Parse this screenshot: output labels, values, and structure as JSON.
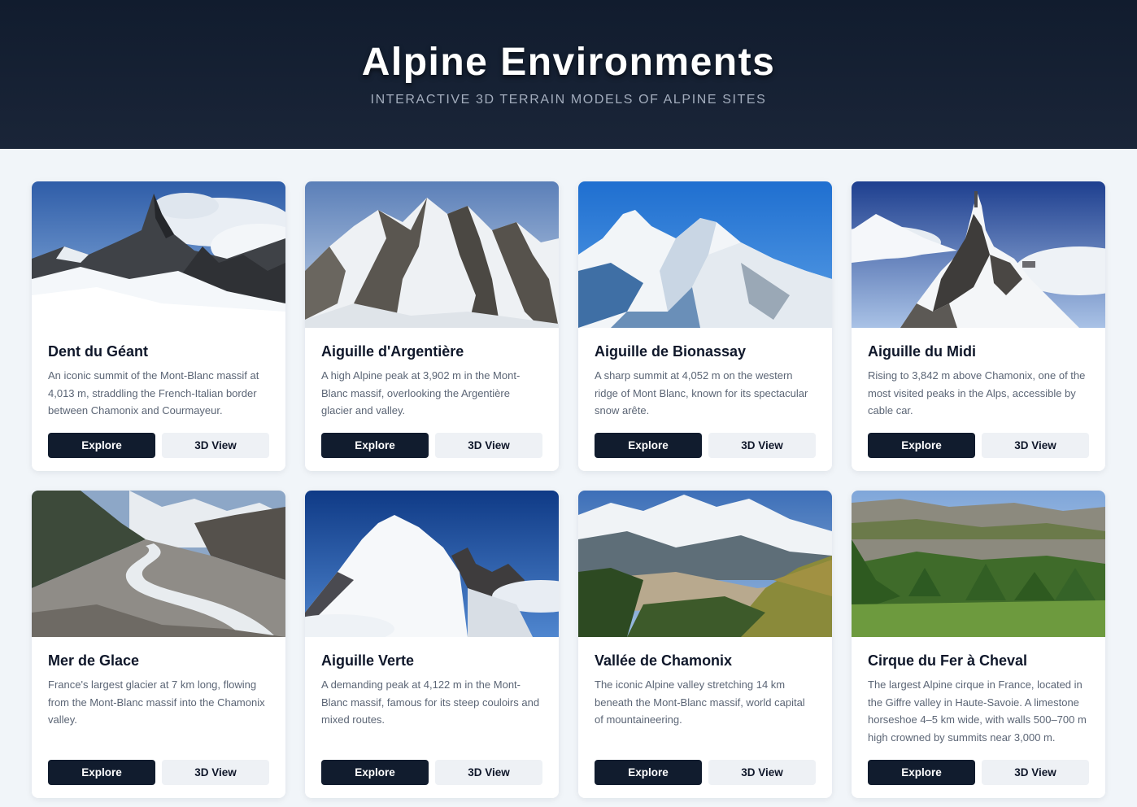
{
  "header": {
    "title": "Alpine Environments",
    "subtitle": "INTERACTIVE 3D TERRAIN MODELS OF ALPINE SITES"
  },
  "buttons": {
    "explore": "Explore",
    "view3d": "3D View"
  },
  "cards": [
    {
      "title": "Dent du Géant",
      "description": "An iconic summit of the Mont-Blanc massif at 4,013 m, straddling the French-Italian border between Chamonix and Courmayeur.",
      "image": "jagged rock spire above snowfield"
    },
    {
      "title": "Aiguille d'Argentière",
      "description": "A high Alpine peak at 3,902 m in the Mont-Blanc massif, overlooking the Argentière glacier and valley.",
      "image": "snowy granite peaks"
    },
    {
      "title": "Aiguille de Bionassay",
      "description": "A sharp summit at 4,052 m on the western ridge of Mont Blanc, known for its spectacular snow arête.",
      "image": "snow ridge against blue sky"
    },
    {
      "title": "Aiguille du Midi",
      "description": "Rising to 3,842 m above Chamonix, one of the most visited peaks in the Alps, accessible by cable car.",
      "image": "summit station on rocky needle"
    },
    {
      "title": "Mer de Glace",
      "description": "France's largest glacier at 7 km long, flowing from the Mont-Blanc massif into the Chamonix valley.",
      "image": "glacier valley with moraines"
    },
    {
      "title": "Aiguille Verte",
      "description": "A demanding peak at 4,122 m in the Mont-Blanc massif, famous for its steep couloirs and mixed routes.",
      "image": "snow dome and rock towers"
    },
    {
      "title": "Vallée de Chamonix",
      "description": "The iconic Alpine valley stretching 14 km beneath the Mont-Blanc massif, world capital of mountaineering.",
      "image": "valley town beneath snowy massif"
    },
    {
      "title": "Cirque du Fer à Cheval",
      "description": "The largest Alpine cirque in France, located in the Giffre valley in Haute-Savoie. A limestone horseshoe 4–5 km wide, with walls 500–700 m high crowned by summits near 3,000 m.",
      "image": "limestone cliffs over green forest"
    }
  ],
  "colors": {
    "header_bg": "#111c2e",
    "page_bg": "#f1f5f9",
    "primary_button": "#111c2e",
    "secondary_button": "#eef1f5"
  }
}
